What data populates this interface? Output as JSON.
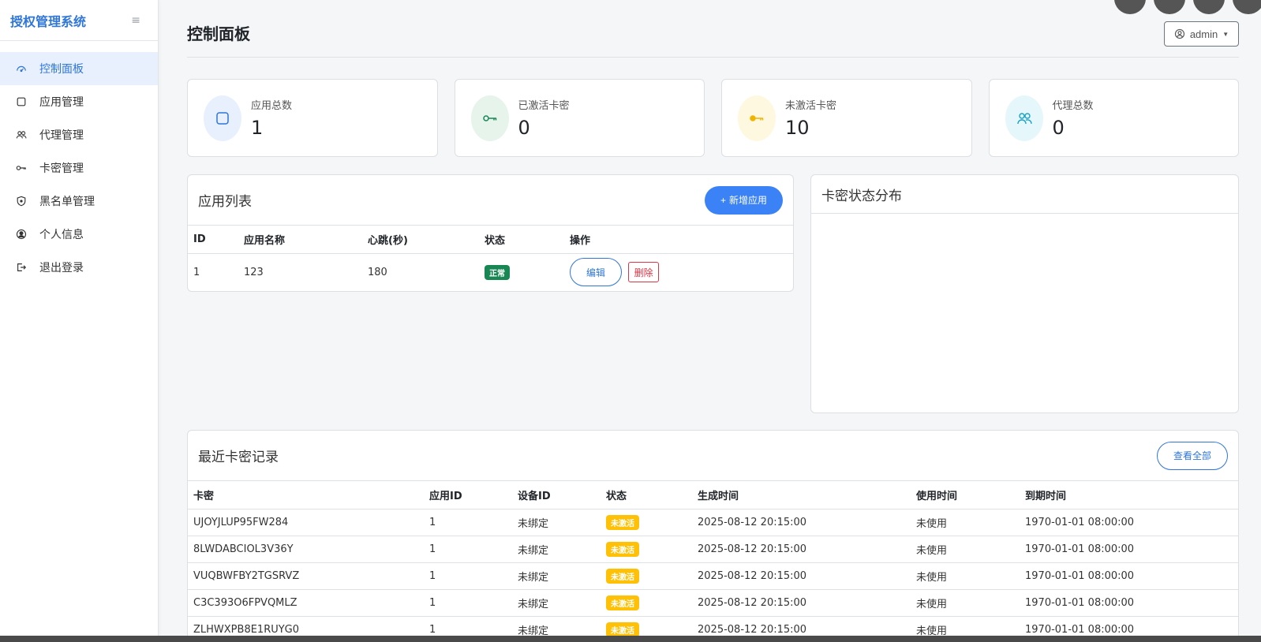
{
  "brand": {
    "title": "授权管理系统",
    "toggle": "≡"
  },
  "nav": [
    {
      "label": "控制面板",
      "icon": "gauge-icon",
      "active": true
    },
    {
      "label": "应用管理",
      "icon": "square-icon"
    },
    {
      "label": "代理管理",
      "icon": "people-icon"
    },
    {
      "label": "卡密管理",
      "icon": "key-icon"
    },
    {
      "label": "黑名单管理",
      "icon": "shield-icon"
    },
    {
      "label": "个人信息",
      "icon": "user-circle-icon"
    },
    {
      "label": "退出登录",
      "icon": "logout-icon"
    }
  ],
  "header": {
    "title": "控制面板",
    "user": "admin"
  },
  "stats": [
    {
      "label": "应用总数",
      "value": "1",
      "color": "#2f76d8",
      "bg": "#e8f0fe",
      "icon": "square-icon"
    },
    {
      "label": "已激活卡密",
      "value": "0",
      "color": "#198754",
      "bg": "#e6f4ec",
      "icon": "key-icon"
    },
    {
      "label": "未激活卡密",
      "value": "10",
      "color": "#f0b400",
      "bg": "#fff8e1",
      "icon": "key-icon"
    },
    {
      "label": "代理总数",
      "value": "0",
      "color": "#17a2c8",
      "bg": "#e6f7fb",
      "icon": "people-icon"
    }
  ],
  "apps": {
    "title": "应用列表",
    "add_label": "新增应用",
    "columns": [
      "ID",
      "应用名称",
      "心跳(秒)",
      "状态",
      "操作"
    ],
    "rows": [
      {
        "id": "1",
        "name": "123",
        "heartbeat": "180",
        "status": "正常",
        "edit": "编辑",
        "delete": "删除"
      }
    ]
  },
  "distribution": {
    "title": "卡密状态分布"
  },
  "cards": {
    "title": "最近卡密记录",
    "view_all": "查看全部",
    "columns": [
      "卡密",
      "应用ID",
      "设备ID",
      "状态",
      "生成时间",
      "使用时间",
      "到期时间"
    ],
    "rows": [
      {
        "key": "UJOYJLUP95FW284",
        "app_id": "1",
        "device": "未绑定",
        "status": "未激活",
        "created": "2025-08-12 20:15:00",
        "used": "未使用",
        "expires": "1970-01-01 08:00:00"
      },
      {
        "key": "8LWDABCIOL3V36Y",
        "app_id": "1",
        "device": "未绑定",
        "status": "未激活",
        "created": "2025-08-12 20:15:00",
        "used": "未使用",
        "expires": "1970-01-01 08:00:00"
      },
      {
        "key": "VUQBWFBY2TGSRVZ",
        "app_id": "1",
        "device": "未绑定",
        "status": "未激活",
        "created": "2025-08-12 20:15:00",
        "used": "未使用",
        "expires": "1970-01-01 08:00:00"
      },
      {
        "key": "C3C393O6FPVQMLZ",
        "app_id": "1",
        "device": "未绑定",
        "status": "未激活",
        "created": "2025-08-12 20:15:00",
        "used": "未使用",
        "expires": "1970-01-01 08:00:00"
      },
      {
        "key": "ZLHWXPB8E1RUYG0",
        "app_id": "1",
        "device": "未绑定",
        "status": "未激活",
        "created": "2025-08-12 20:15:00",
        "used": "未使用",
        "expires": "1970-01-01 08:00:00"
      }
    ]
  }
}
